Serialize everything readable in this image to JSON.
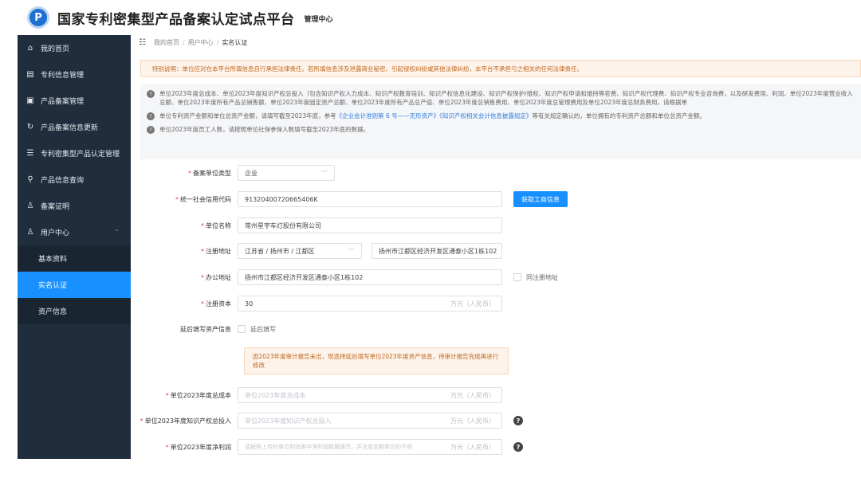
{
  "app": {
    "logo_text": "P",
    "title": "国家专利密集型产品备案认定试点平台",
    "subtitle": "管理中心"
  },
  "sidebar": {
    "items": [
      {
        "label": "我的首页",
        "icon": "home-icon",
        "glyph": "⌂"
      },
      {
        "label": "专利信息管理",
        "icon": "document-icon",
        "glyph": "▤"
      },
      {
        "label": "产品备案管理",
        "icon": "folder-icon",
        "glyph": "▣"
      },
      {
        "label": "产品备案信息更新",
        "icon": "refresh-icon",
        "glyph": "↻"
      },
      {
        "label": "专利密集型产品认定管理",
        "icon": "list-icon",
        "glyph": "☰"
      },
      {
        "label": "产品信息查询",
        "icon": "search-icon",
        "glyph": "⚲"
      },
      {
        "label": "备案证明",
        "icon": "certificate-icon",
        "glyph": "♙"
      },
      {
        "label": "用户中心",
        "icon": "user-icon",
        "glyph": "♙",
        "chevron": "⌃"
      }
    ],
    "sub_items": [
      {
        "label": "基本资料"
      },
      {
        "label": "实名认证",
        "active": true
      },
      {
        "label": "资产信息"
      }
    ]
  },
  "breadcrumb": {
    "menu_icon": "☷",
    "items": [
      "我的首页",
      "用户中心",
      "实名认证"
    ],
    "separator": "/"
  },
  "notices": {
    "warning": "特别说明：单位应对在本平台所填信息自行承担法律责任。若所填信息涉及泄露商业秘密、引起侵权纠纷或其他法律纠纷，本平台不承担与之相关的任何法律责任。",
    "info": [
      {
        "text": "单位2023年度总成本、单位2023年度知识产权总投入（包含知识产权人力成本、知识产权教育培训、知识产权信息化建设、知识产权保护/维权、知识产权申请和维持等官费、知识产权代理费、知识产权专业咨询费，以及研发费用、利润、单位2023年度营业收入总额、单位2023年度所有产品总销售额、单位2023年度固定资产总额、单位2023年度所有产品总产值、单位2023年度总销售费用、单位2023年度总管理费用及单位2023年度总财务费用，请根据单"
      },
      {
        "text_before": "单位专利资产金额和单位总资产金额，请填写截至2023年底，参考",
        "link1": "《企业会计准则第 6 号——无形资产》",
        "link2": "《知识产权相关会计信息披露规定》",
        "text_after": "等有关规定确认的，单位拥有的专利资产总额和单位总资产金额。"
      },
      {
        "text": "单位2023年度员工人数，请按照单位社保参保人数填写截至2023年底的数据。"
      }
    ],
    "info_icon": "!"
  },
  "form": {
    "unit_type": {
      "label": "备案单位类型",
      "value": "企业",
      "arrow": "﹀"
    },
    "credit_code": {
      "label": "统一社会信用代码",
      "value": "91320400720665406K",
      "button": "获取工商信息"
    },
    "unit_name": {
      "label": "单位名称",
      "value": "常州星宇车灯股份有限公司"
    },
    "reg_address": {
      "label": "注册地址",
      "region": "江苏省 / 扬州市 / 江都区",
      "arrow": "﹀",
      "detail": "扬州市江都区经济开发区通泰小区1栋102"
    },
    "office_address": {
      "label": "办公地址",
      "value": "扬州市江都区经济开发区通泰小区1栋102",
      "same_label": "同注册地址"
    },
    "reg_capital": {
      "label": "注册资本",
      "value": "30",
      "unit": "万元（人民币）"
    },
    "delay_fill": {
      "label": "延后填写资产信息",
      "checkbox_label": "延后填写"
    },
    "delay_note": "因2023年度审计报告未出，现选择延后填写单位2023年度资产信息，待审计报告完成再进行修改",
    "total_cost": {
      "label": "单位2023年度总成本",
      "placeholder": "单位2023年度总成本",
      "unit": "万元（人民币）"
    },
    "ip_invest": {
      "label": "单位2023年度知识产权总投入",
      "placeholder": "单位2023年度知识产权总投入",
      "unit": "万元（人民币）",
      "help": "?"
    },
    "net_profit": {
      "label": "单位2023年度净利润",
      "placeholder": "请按照上传的单位利润表中净利润数据填写，并注意金额单位的不同",
      "unit": "万元（人民币）",
      "help": "?"
    },
    "required_mark": "*"
  },
  "colors": {
    "sidebar_bg": "#1f2d3d",
    "active_bg": "#1890ff",
    "warning_text": "#c0671c",
    "link": "#2f7fe0"
  }
}
